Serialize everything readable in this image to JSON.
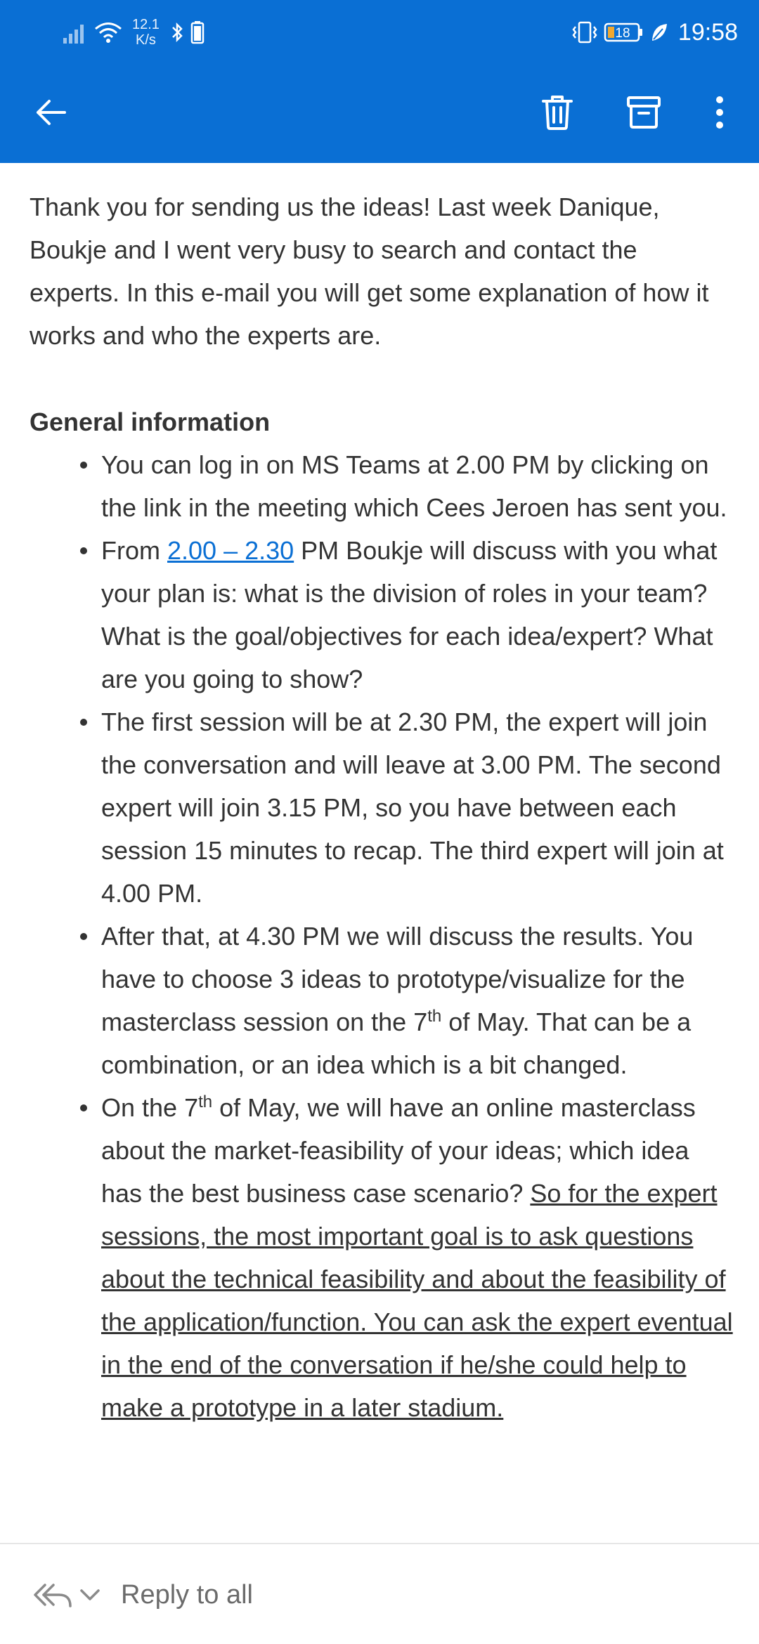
{
  "status_bar": {
    "net_speed_value": "12.1",
    "net_speed_unit": "K/s",
    "battery_level": "18",
    "time": "19:58"
  },
  "colors": {
    "brand_blue": "#0a6fd4",
    "text": "#333333",
    "link": "#0a6fd4"
  },
  "app_bar": {
    "icons": [
      "back-arrow-icon",
      "trash-icon",
      "archive-icon",
      "more-vertical-icon"
    ]
  },
  "email": {
    "intro": "Thank you for sending us the ideas! Last week Danique, Boukje and I went very busy to search and contact the experts. In this e-mail you will get some explanation of how it works and who the experts are.",
    "section_heading": "General information",
    "bullets": {
      "b1": "You can log in on MS Teams at 2.00 PM by clicking on the link in the meeting which Cees Jeroen has sent you.",
      "b2_pre": "From ",
      "b2_link": "2.00 – 2.30",
      "b2_post": " PM Boukje will discuss with you what your plan is: what is the division of roles in your team? What is the goal/objectives for each idea/expert? What are you going to show?",
      "b3": "The first session will be at 2.30 PM, the expert will join the conversation and will leave at 3.00 PM. The second expert will join 3.15 PM, so you have between each session 15 minutes to recap. The third expert will join at 4.00 PM.",
      "b4_pre": "After that, at 4.30 PM we will discuss the results. You have to choose 3 ideas to prototype/visualize for the masterclass session on the 7",
      "b4_sup": "th",
      "b4_post": " of May. That can be a combination, or an idea which is a bit changed.",
      "b5_pre": "On the 7",
      "b5_sup": "th",
      "b5_mid": " of May, we will have an online masterclass about the market-feasibility of your ideas; which idea has the best business case scenario? ",
      "b5_underlined": "So for the expert sessions, the most important goal is to ask questions about the technical feasibility and about the feasibility of the application/function. You can ask the expert eventual in the end of the conversation if he/she could help to make a prototype in a later stadium."
    }
  },
  "bottom_bar": {
    "reply_label": "Reply to all"
  }
}
